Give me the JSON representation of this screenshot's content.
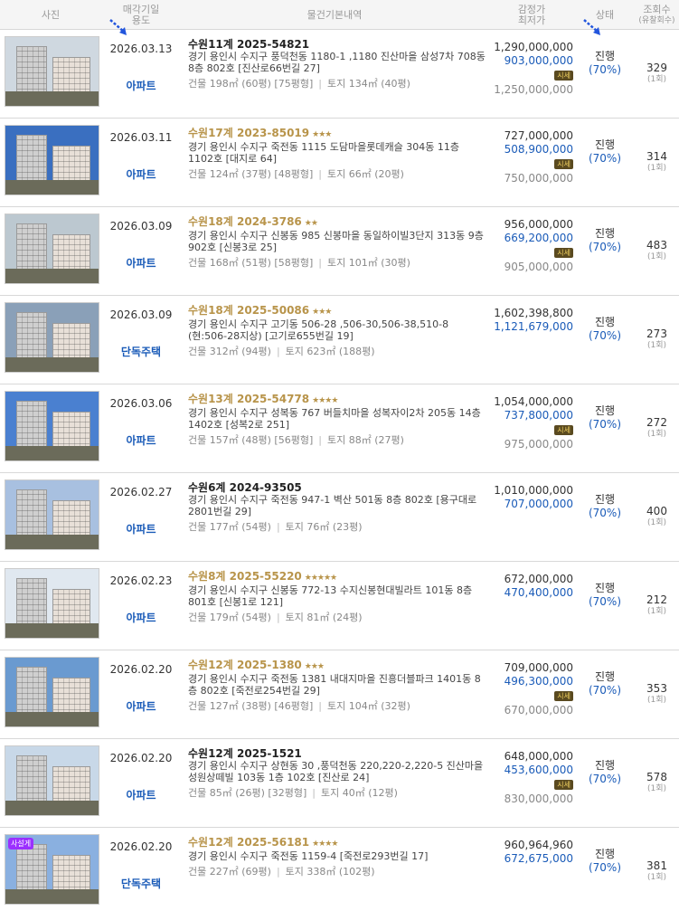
{
  "header": {
    "photo": "사진",
    "date_1": "매각기일",
    "date_2": "용도",
    "info": "물건기본내역",
    "price_1": "감정가",
    "price_2": "최저가",
    "status": "상태",
    "views_1": "조회수",
    "views_2": "(유찰회수)"
  },
  "rows": [
    {
      "date": "2026.03.13",
      "usage": "아파트",
      "case": "수원11계 2025-54821",
      "stars": "",
      "addr": "경기 용인시 수지구 풍덕천동 1180-1 ,1180 진산마을 삼성7차 708동 8층 802호 [진산로66번길 27]",
      "area_bldg": "건물 198㎡ (60평) [75평형]",
      "area_land": "토지 134㎡ (40평)",
      "appraisal": "1,290,000,000",
      "minbid": "903,000,000",
      "sise": "시세",
      "prev": "1,250,000,000",
      "status": "진행",
      "pct": "(70%)",
      "views": "329",
      "fail": "(1회)"
    },
    {
      "date": "2026.03.11",
      "usage": "아파트",
      "case": "수원17계 2023-85019",
      "stars": "★★★",
      "addr": "경기 용인시 수지구 죽전동 1115 도담마을롯데캐슬 304동 11층 1102호 [대지로 64]",
      "area_bldg": "건물 124㎡ (37평) [48평형]",
      "area_land": "토지 66㎡ (20평)",
      "appraisal": "727,000,000",
      "minbid": "508,900,000",
      "sise": "시세",
      "prev": "750,000,000",
      "status": "진행",
      "pct": "(70%)",
      "views": "314",
      "fail": "(1회)"
    },
    {
      "date": "2026.03.09",
      "usage": "아파트",
      "case": "수원18계 2024-3786",
      "stars": "★★",
      "addr": "경기 용인시 수지구 신봉동 985 신봉마을 동일하이빌3단지 313동 9층 902호 [신봉3로 25]",
      "area_bldg": "건물 168㎡ (51평) [58평형]",
      "area_land": "토지 101㎡ (30평)",
      "appraisal": "956,000,000",
      "minbid": "669,200,000",
      "sise": "시세",
      "prev": "905,000,000",
      "status": "진행",
      "pct": "(70%)",
      "views": "483",
      "fail": "(1회)"
    },
    {
      "date": "2026.03.09",
      "usage": "단독주택",
      "case": "수원18계 2025-50086",
      "stars": "★★★",
      "addr": "경기 용인시 수지구 고기동 506-28 ,506-30,506-38,510-8 (현:506-28지상) [고기로655번길 19]",
      "area_bldg": "건물 312㎡ (94평)",
      "area_land": "토지 623㎡ (188평)",
      "appraisal": "1,602,398,800",
      "minbid": "1,121,679,000",
      "sise": "",
      "prev": "",
      "status": "진행",
      "pct": "(70%)",
      "views": "273",
      "fail": "(1회)"
    },
    {
      "date": "2026.03.06",
      "usage": "아파트",
      "case": "수원13계 2025-54778",
      "stars": "★★★★",
      "addr": "경기 용인시 수지구 성복동 767 버들치마을 성복자이2차 205동 14층 1402호 [성복2로 251]",
      "area_bldg": "건물 157㎡ (48평) [56평형]",
      "area_land": "토지 88㎡ (27평)",
      "appraisal": "1,054,000,000",
      "minbid": "737,800,000",
      "sise": "시세",
      "prev": "975,000,000",
      "status": "진행",
      "pct": "(70%)",
      "views": "272",
      "fail": "(1회)"
    },
    {
      "date": "2026.02.27",
      "usage": "아파트",
      "case": "수원6계 2024-93505",
      "stars": "",
      "addr": "경기 용인시 수지구 죽전동 947-1 벽산 501동 8층 802호 [용구대로2801번길 29]",
      "area_bldg": "건물 177㎡ (54평)",
      "area_land": "토지 76㎡ (23평)",
      "appraisal": "1,010,000,000",
      "minbid": "707,000,000",
      "sise": "",
      "prev": "",
      "status": "진행",
      "pct": "(70%)",
      "views": "400",
      "fail": "(1회)"
    },
    {
      "date": "2026.02.23",
      "usage": "아파트",
      "case": "수원8계 2025-55220",
      "stars": "★★★★★",
      "addr": "경기 용인시 수지구 신봉동 772-13 수지신봉현대빌라트 101동 8층 801호 [신봉1로 121]",
      "area_bldg": "건물 179㎡ (54평)",
      "area_land": "토지 81㎡ (24평)",
      "appraisal": "672,000,000",
      "minbid": "470,400,000",
      "sise": "",
      "prev": "",
      "status": "진행",
      "pct": "(70%)",
      "views": "212",
      "fail": "(1회)"
    },
    {
      "date": "2026.02.20",
      "usage": "아파트",
      "case": "수원12계 2025-1380",
      "stars": "★★★",
      "addr": "경기 용인시 수지구 죽전동 1381 내대지마을 진흥더블파크 1401동 8층 802호 [죽전로254번길 29]",
      "area_bldg": "건물 127㎡ (38평) [46평형]",
      "area_land": "토지 104㎡ (32평)",
      "appraisal": "709,000,000",
      "minbid": "496,300,000",
      "sise": "시세",
      "prev": "670,000,000",
      "status": "진행",
      "pct": "(70%)",
      "views": "353",
      "fail": "(1회)"
    },
    {
      "date": "2026.02.20",
      "usage": "아파트",
      "case": "수원12계 2025-1521",
      "stars": "",
      "addr": "경기 용인시 수지구 상현동 30 ,풍덕천동 220,220-2,220-5 진산마을 성원상떼빌 103동 1층 102호 [진산로 24]",
      "area_bldg": "건물 85㎡ (26평) [32평형]",
      "area_land": "토지 40㎡ (12평)",
      "appraisal": "648,000,000",
      "minbid": "453,600,000",
      "sise": "시세",
      "prev": "830,000,000",
      "status": "진행",
      "pct": "(70%)",
      "views": "578",
      "fail": "(1회)"
    },
    {
      "date": "2026.02.20",
      "usage": "단독주택",
      "case": "수원12계 2025-56181",
      "stars": "★★★★",
      "addr": "경기 용인시 수지구 죽전동 1159-4 [죽전로293번길 17]",
      "area_bldg": "건물 227㎡ (69평)",
      "area_land": "토지 338㎡ (102평)",
      "appraisal": "960,964,960",
      "minbid": "672,675,000",
      "sise": "",
      "prev": "",
      "status": "진행",
      "pct": "(70%)",
      "views": "381",
      "fail": "(1회)",
      "special": "사설게"
    }
  ],
  "colors": {
    "accent_blue": "#1a5bb8",
    "case_gold": "#b8944a",
    "special_purple": "#9b30ff"
  }
}
